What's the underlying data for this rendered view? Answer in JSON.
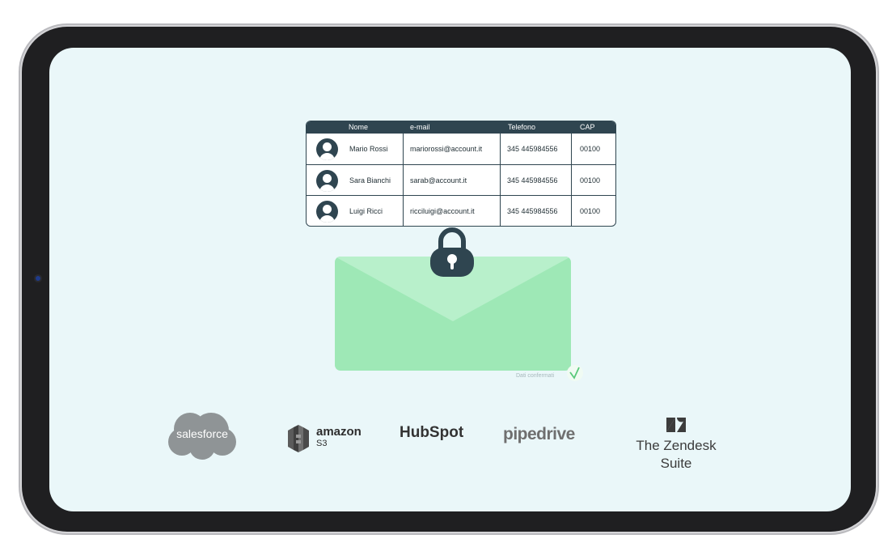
{
  "table": {
    "headers": [
      "Nome",
      "e-mail",
      "Telefono",
      "CAP"
    ],
    "rows": [
      {
        "name": "Mario Rossi",
        "email": "mariorossi@account.it",
        "phone": "345 445984556",
        "cap": "00100"
      },
      {
        "name": "Sara Bianchi",
        "email": "sarab@account.it",
        "phone": "345 445984556",
        "cap": "00100"
      },
      {
        "name": "Luigi Ricci",
        "email": "ricciluigi@account.it",
        "phone": "345 445984556",
        "cap": "00100"
      }
    ]
  },
  "status": {
    "confirmed_label": "Dati confermati"
  },
  "logos": {
    "salesforce": "salesforce",
    "amazon_main": "amazon",
    "amazon_sub": "S3",
    "hubspot": "HubSpot",
    "pipedrive": "pipedrive",
    "zendesk": "The Zendesk Suite"
  },
  "icons": [
    "avatar-icon",
    "lock-icon",
    "envelope-icon",
    "check-icon",
    "zendesk-logo-icon",
    "s3-logo-icon"
  ],
  "colors": {
    "table_header": "#2f4550",
    "screen_bg": "#eaf7f9",
    "envelope": "#9ee8b6",
    "envelope_flap": "#b8f0cb",
    "check": "#59c97a"
  }
}
